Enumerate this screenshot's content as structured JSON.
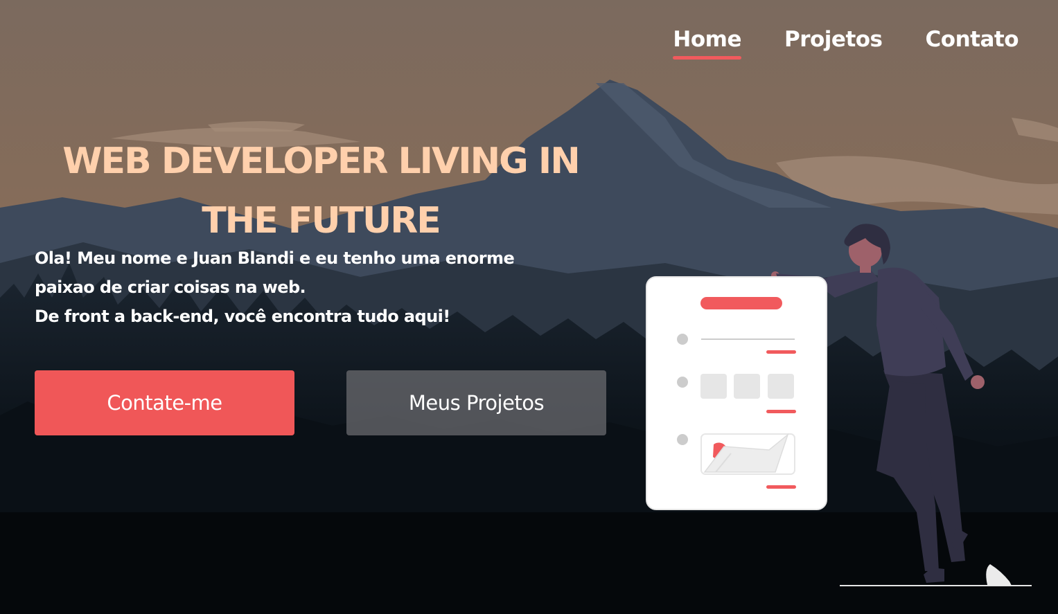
{
  "nav": {
    "items": [
      {
        "label": "Home",
        "active": true
      },
      {
        "label": "Projetos",
        "active": false
      },
      {
        "label": "Contato",
        "active": false
      }
    ]
  },
  "hero": {
    "title_line1": "WEB DEVELOPER LIVING IN",
    "title_line2": "THE FUTURE",
    "intro_line1": "Ola! Meu nome e Juan Blandi e eu tenho uma enorme",
    "intro_line2": "paixao de criar coisas na web.",
    "intro_line3": "De front a back-end, você encontra tudo aqui!",
    "primary_button": "Contate-me",
    "secondary_button": "Meus Projetos"
  },
  "colors": {
    "accent": "#f15a5d",
    "title": "#ffd0ac",
    "sky": "#7f6a5d"
  },
  "icons": {
    "illustration": "person-with-website-card-illustration"
  }
}
